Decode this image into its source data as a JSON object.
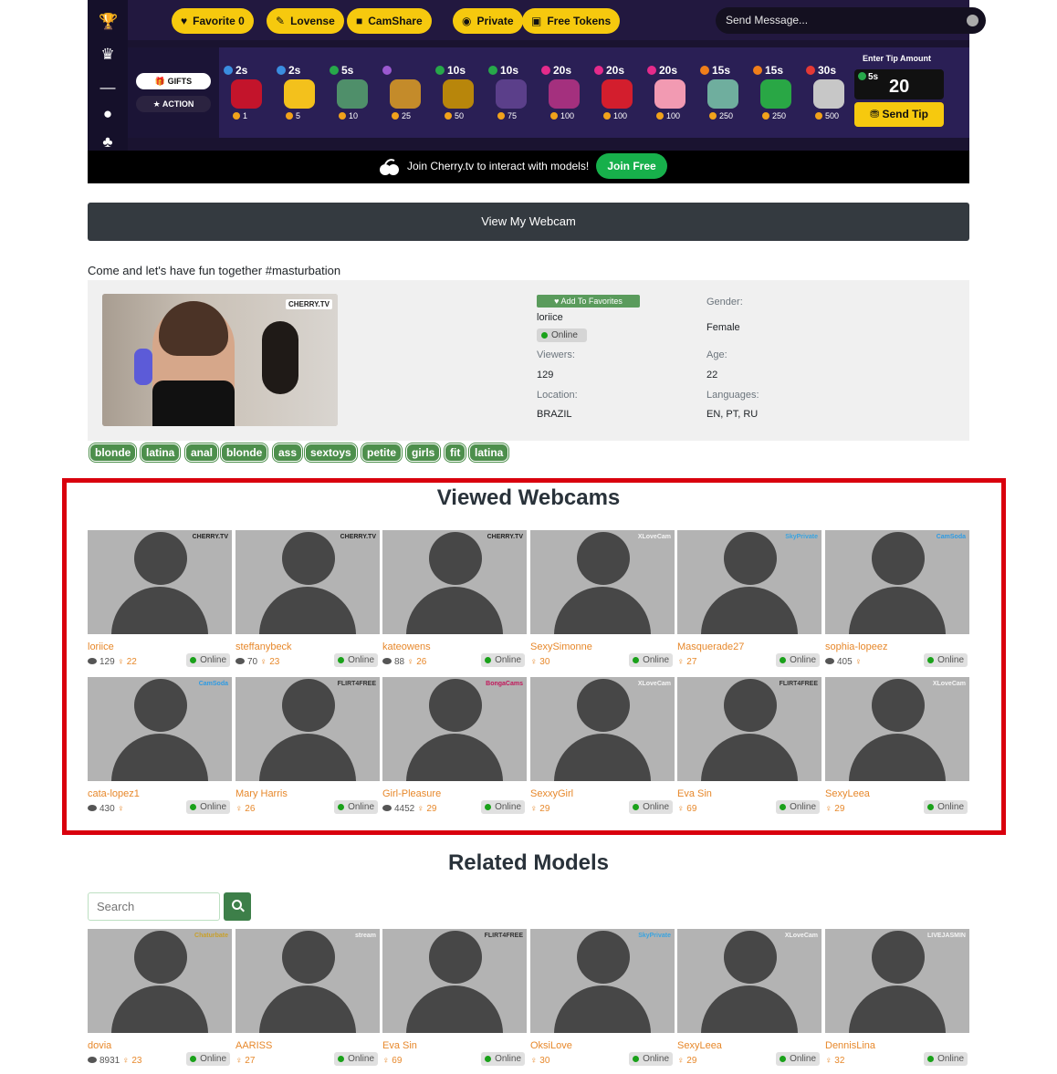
{
  "player": {
    "pills": [
      {
        "label": "Favorite  0",
        "icon": "♥"
      },
      {
        "label": "Lovense",
        "icon": "✎"
      },
      {
        "label": "CamShare",
        "icon": "■"
      },
      {
        "label": "Private",
        "icon": "◉"
      },
      {
        "label": "Free Tokens",
        "icon": "▣"
      }
    ],
    "send_message": "Send Message...",
    "gifts_label": "GIFTS",
    "action_label": "ACTION",
    "gifts": [
      {
        "time": "2s",
        "price": "1",
        "dot": "#3a8de0",
        "color": "#c3142b"
      },
      {
        "time": "2s",
        "price": "5",
        "dot": "#3a8de0",
        "color": "#f3c11c"
      },
      {
        "time": "5s",
        "price": "10",
        "dot": "#27a84a",
        "color": "#4f8f6a"
      },
      {
        "time": "",
        "price": "25",
        "dot": "#9b59d0",
        "color": "#c48b2a"
      },
      {
        "time": "10s",
        "price": "50",
        "dot": "#27a84a",
        "color": "#b8860b"
      },
      {
        "time": "10s",
        "price": "75",
        "dot": "#27a84a",
        "color": "#5b3f8a"
      },
      {
        "time": "20s",
        "price": "100",
        "dot": "#e52b8b",
        "color": "#a4307e"
      },
      {
        "time": "20s",
        "price": "100",
        "dot": "#e52b8b",
        "color": "#d31e2d"
      },
      {
        "time": "20s",
        "price": "100",
        "dot": "#e52b8b",
        "color": "#f29ab2"
      },
      {
        "time": "15s",
        "price": "250",
        "dot": "#f07f1a",
        "color": "#6fae9e"
      },
      {
        "time": "15s",
        "price": "250",
        "dot": "#f07f1a",
        "color": "#29a745"
      },
      {
        "time": "30s",
        "price": "500",
        "dot": "#e53935",
        "color": "#c7c7c7"
      }
    ],
    "tip_title": "Enter Tip Amount",
    "tip_time": "5s",
    "tip_value": "20",
    "send_tip": "Send Tip",
    "join_text": "Join Cherry.tv to interact with models!",
    "join_button": "Join Free"
  },
  "view_webcam": "View My Webcam",
  "intro": "Come and let's have fun together #masturbation",
  "profile": {
    "thumb_brand": "CHERRY.TV",
    "add_favorites": "♥ Add To Favorites",
    "username": "loriice",
    "status": "Online",
    "viewers_label": "Viewers:",
    "viewers": "129",
    "location_label": "Location:",
    "location": "BRAZIL",
    "gender_label": "Gender:",
    "gender": "Female",
    "age_label": "Age:",
    "age": "22",
    "languages_label": "Languages:",
    "languages": "EN, PT, RU"
  },
  "tags": [
    "blonde",
    "latina",
    "anal",
    "blonde",
    "ass",
    "sextoys",
    "petite",
    "girls",
    "fit",
    "latina"
  ],
  "viewed": {
    "title": "Viewed Webcams",
    "cards": [
      {
        "name": "loriice",
        "viewers": "129",
        "age": "22",
        "brand": "CHERRY.TV",
        "brand_color": "#222"
      },
      {
        "name": "steffanybeck",
        "viewers": "70",
        "age": "23",
        "brand": "CHERRY.TV",
        "brand_color": "#222"
      },
      {
        "name": "kateowens",
        "viewers": "88",
        "age": "26",
        "brand": "CHERRY.TV",
        "brand_color": "#222"
      },
      {
        "name": "SexySimonne",
        "viewers": "",
        "age": "30",
        "brand": "XLoveCam",
        "brand_color": "#f4f4f4"
      },
      {
        "name": "Masquerade27",
        "viewers": "",
        "age": "27",
        "brand": "SkyPrivate",
        "brand_color": "#3aa4e0"
      },
      {
        "name": "sophia-lopeez",
        "viewers": "405",
        "age": "",
        "brand": "CamSoda",
        "brand_color": "#2e9be3"
      },
      {
        "name": "cata-lopez1",
        "viewers": "430",
        "age": "",
        "brand": "CamSoda",
        "brand_color": "#2e9be3"
      },
      {
        "name": "Mary Harris",
        "viewers": "",
        "age": "26",
        "brand": "FLIRT4FREE",
        "brand_color": "#333"
      },
      {
        "name": "Girl-Pleasure",
        "viewers": "4452",
        "age": "29",
        "brand": "BongaCams",
        "brand_color": "#c2185b"
      },
      {
        "name": "SexxyGirl",
        "viewers": "",
        "age": "29",
        "brand": "XLoveCam",
        "brand_color": "#f4f4f4"
      },
      {
        "name": "Eva Sin",
        "viewers": "",
        "age": "69",
        "brand": "FLIRT4FREE",
        "brand_color": "#333"
      },
      {
        "name": "SexyLeea",
        "viewers": "",
        "age": "29",
        "brand": "XLoveCam",
        "brand_color": "#f4f4f4"
      }
    ]
  },
  "related": {
    "title": "Related Models",
    "search_placeholder": "Search",
    "cards": [
      {
        "name": "dovia",
        "viewers": "8931",
        "age": "23",
        "brand": "Chaturbate",
        "brand_color": "#c8a02c"
      },
      {
        "name": "AARISS",
        "viewers": "",
        "age": "27",
        "brand": "stream",
        "brand_color": "#f4f4f4"
      },
      {
        "name": "Eva Sin",
        "viewers": "",
        "age": "69",
        "brand": "FLIRT4FREE",
        "brand_color": "#333"
      },
      {
        "name": "OksiLove",
        "viewers": "",
        "age": "30",
        "brand": "SkyPrivate",
        "brand_color": "#3aa4e0"
      },
      {
        "name": "SexyLeea",
        "viewers": "",
        "age": "29",
        "brand": "XLoveCam",
        "brand_color": "#f4f4f4"
      },
      {
        "name": "DennisLina",
        "viewers": "",
        "age": "32",
        "brand": "LIVEJASMIN",
        "brand_color": "#f4f4f4"
      }
    ]
  },
  "online_label": "Online",
  "female_symbol": "♀"
}
